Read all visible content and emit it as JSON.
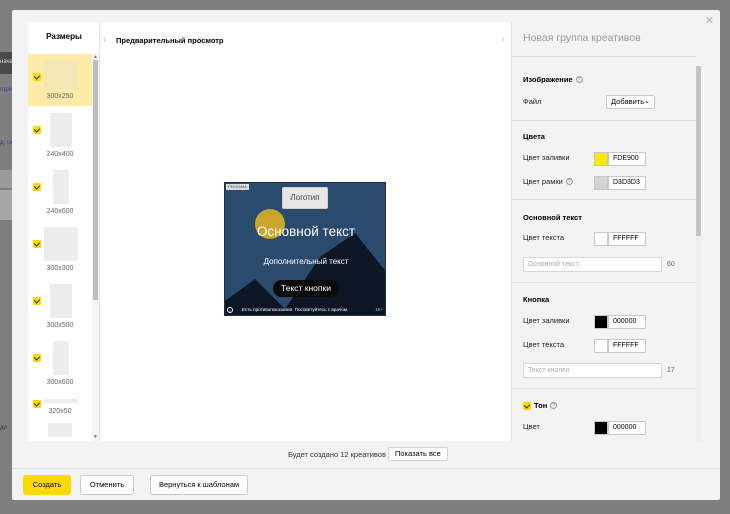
{
  "background": {
    "fragments": [
      "нача",
      "горе",
      "д, ск",
      "до"
    ]
  },
  "modal": {
    "sizes": {
      "title": "Размеры",
      "items": [
        {
          "label": "300x250",
          "selected": true,
          "checked": true
        },
        {
          "label": "240x400",
          "selected": false,
          "checked": true
        },
        {
          "label": "240x600",
          "selected": false,
          "checked": true
        },
        {
          "label": "300x300",
          "selected": false,
          "checked": true
        },
        {
          "label": "300x500",
          "selected": false,
          "checked": true
        },
        {
          "label": "300x600",
          "selected": false,
          "checked": true
        },
        {
          "label": "320x50",
          "selected": false,
          "checked": true
        }
      ]
    },
    "preview": {
      "title": "Предварительный просмотр",
      "ad": {
        "badge": "РЕКЛАМА",
        "logo": "Логотип",
        "main_text": "Основной текст",
        "sub_text": "Дополнительный текст",
        "button_text": "Текст кнопки",
        "disclaimer": "Есть противопоказания. Посоветуйтесь с врачом.",
        "age": "18+",
        "colors": {
          "background": "#2a4a6e",
          "sun": "#c9a52d",
          "mountains": "#0d1624"
        }
      }
    },
    "panel": {
      "title": "Новая группа креативов",
      "image": {
        "heading": "Изображение",
        "file_label": "Файл",
        "add_label": "Добавить"
      },
      "colors": {
        "heading": "Цвета",
        "fill_label": "Цвет заливки",
        "fill_value": "FDE900",
        "fill_swatch": "#FDE900",
        "border_label": "Цвет рамки",
        "border_value": "D3D3D3",
        "border_swatch": "#D3D3D3"
      },
      "main_text": {
        "heading": "Основной текст",
        "text_color_label": "Цвет текста",
        "text_color_value": "FFFFFF",
        "text_color_swatch": "#FFFFFF",
        "placeholder": "Основной текст",
        "limit": "60"
      },
      "button": {
        "heading": "Кнопка",
        "fill_label": "Цвет заливки",
        "fill_value": "000000",
        "fill_swatch": "#000000",
        "text_color_label": "Цвет текста",
        "text_color_value": "FFFFFF",
        "text_color_swatch": "#FFFFFF",
        "placeholder": "Текст кнопки",
        "limit": "17"
      },
      "tone": {
        "heading": "Тон",
        "checked": true,
        "color_label": "Цвет",
        "color_value": "000000",
        "color_swatch": "#000000"
      }
    },
    "footer": {
      "info": "Будет создано 12 креативов",
      "show_all": "Показать все",
      "create": "Создать",
      "cancel": "Отменить",
      "back": "Вернуться к шаблонам"
    }
  }
}
